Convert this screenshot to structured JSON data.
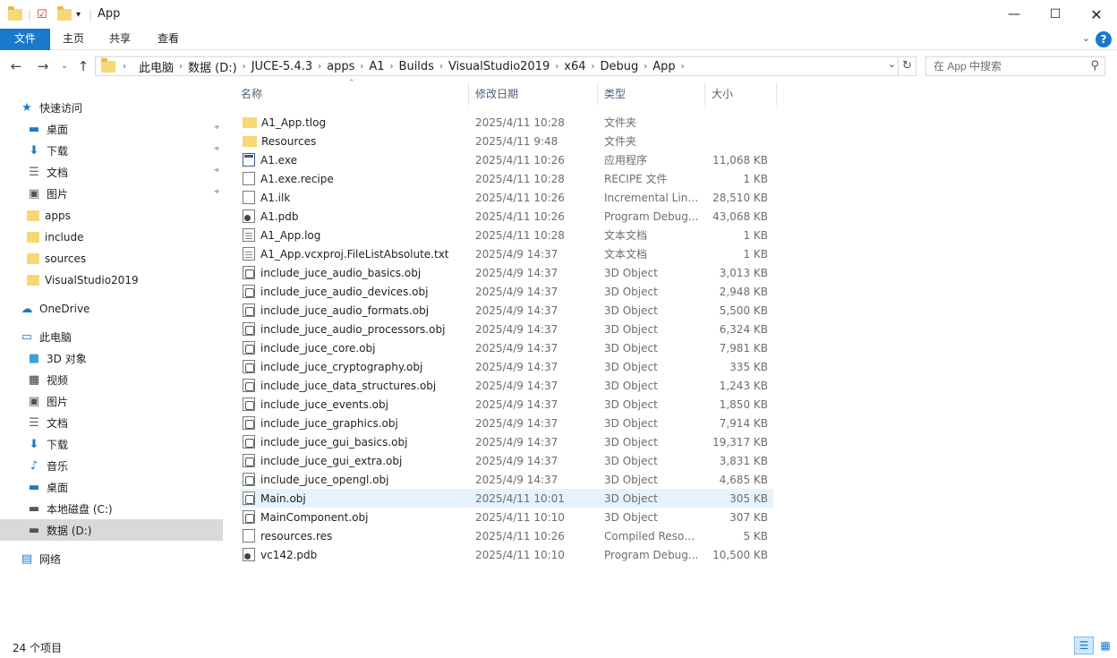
{
  "window": {
    "title": "App"
  },
  "ribbon": {
    "tabs": [
      "文件",
      "主页",
      "共享",
      "查看"
    ],
    "help": "?"
  },
  "address": {
    "crumbs": [
      "此电脑",
      "数据 (D:)",
      "JUCE-5.4.3",
      "apps",
      "A1",
      "Builds",
      "VisualStudio2019",
      "x64",
      "Debug",
      "App"
    ]
  },
  "search": {
    "placeholder": "在 App 中搜索"
  },
  "sidebar": {
    "items": [
      {
        "label": "快速访问",
        "icon": "star-icon"
      },
      {
        "label": "桌面",
        "icon": "desktop-icon",
        "pinned": true
      },
      {
        "label": "下载",
        "icon": "download-icon",
        "pinned": true
      },
      {
        "label": "文档",
        "icon": "document-icon",
        "pinned": true
      },
      {
        "label": "图片",
        "icon": "picture-icon",
        "pinned": true
      },
      {
        "label": "apps",
        "icon": "folder-icon"
      },
      {
        "label": "include",
        "icon": "folder-icon"
      },
      {
        "label": "sources",
        "icon": "folder-icon"
      },
      {
        "label": "VisualStudio2019",
        "icon": "folder-icon"
      },
      {
        "label": "OneDrive",
        "icon": "cloud-icon"
      },
      {
        "label": "此电脑",
        "icon": "computer-icon"
      },
      {
        "label": "3D 对象",
        "icon": "cube-icon"
      },
      {
        "label": "视频",
        "icon": "video-icon"
      },
      {
        "label": "图片",
        "icon": "picture-icon"
      },
      {
        "label": "文档",
        "icon": "document-icon"
      },
      {
        "label": "下载",
        "icon": "download-icon"
      },
      {
        "label": "音乐",
        "icon": "music-icon"
      },
      {
        "label": "桌面",
        "icon": "desktop-icon"
      },
      {
        "label": "本地磁盘 (C:)",
        "icon": "drive-icon"
      },
      {
        "label": "数据 (D:)",
        "icon": "drive-icon",
        "selected": true
      },
      {
        "label": "网络",
        "icon": "network-icon"
      }
    ]
  },
  "columns": {
    "name": "名称",
    "date": "修改日期",
    "type": "类型",
    "size": "大小"
  },
  "files": [
    {
      "name": "A1_App.tlog",
      "date": "2025/4/11 10:28",
      "type": "文件夹",
      "size": "",
      "icon": "folder"
    },
    {
      "name": "Resources",
      "date": "2025/4/11 9:48",
      "type": "文件夹",
      "size": "",
      "icon": "folder"
    },
    {
      "name": "A1.exe",
      "date": "2025/4/11 10:26",
      "type": "应用程序",
      "size": "11,068 KB",
      "icon": "exe"
    },
    {
      "name": "A1.exe.recipe",
      "date": "2025/4/11 10:28",
      "type": "RECIPE 文件",
      "size": "1 KB",
      "icon": "file"
    },
    {
      "name": "A1.ilk",
      "date": "2025/4/11 10:26",
      "type": "Incremental Link...",
      "size": "28,510 KB",
      "icon": "file"
    },
    {
      "name": "A1.pdb",
      "date": "2025/4/11 10:26",
      "type": "Program Debug...",
      "size": "43,068 KB",
      "icon": "pdb"
    },
    {
      "name": "A1_App.log",
      "date": "2025/4/11 10:28",
      "type": "文本文档",
      "size": "1 KB",
      "icon": "txt"
    },
    {
      "name": "A1_App.vcxproj.FileListAbsolute.txt",
      "date": "2025/4/9 14:37",
      "type": "文本文档",
      "size": "1 KB",
      "icon": "txt"
    },
    {
      "name": "include_juce_audio_basics.obj",
      "date": "2025/4/9 14:37",
      "type": "3D Object",
      "size": "3,013 KB",
      "icon": "obj"
    },
    {
      "name": "include_juce_audio_devices.obj",
      "date": "2025/4/9 14:37",
      "type": "3D Object",
      "size": "2,948 KB",
      "icon": "obj"
    },
    {
      "name": "include_juce_audio_formats.obj",
      "date": "2025/4/9 14:37",
      "type": "3D Object",
      "size": "5,500 KB",
      "icon": "obj"
    },
    {
      "name": "include_juce_audio_processors.obj",
      "date": "2025/4/9 14:37",
      "type": "3D Object",
      "size": "6,324 KB",
      "icon": "obj"
    },
    {
      "name": "include_juce_core.obj",
      "date": "2025/4/9 14:37",
      "type": "3D Object",
      "size": "7,981 KB",
      "icon": "obj"
    },
    {
      "name": "include_juce_cryptography.obj",
      "date": "2025/4/9 14:37",
      "type": "3D Object",
      "size": "335 KB",
      "icon": "obj"
    },
    {
      "name": "include_juce_data_structures.obj",
      "date": "2025/4/9 14:37",
      "type": "3D Object",
      "size": "1,243 KB",
      "icon": "obj"
    },
    {
      "name": "include_juce_events.obj",
      "date": "2025/4/9 14:37",
      "type": "3D Object",
      "size": "1,850 KB",
      "icon": "obj"
    },
    {
      "name": "include_juce_graphics.obj",
      "date": "2025/4/9 14:37",
      "type": "3D Object",
      "size": "7,914 KB",
      "icon": "obj"
    },
    {
      "name": "include_juce_gui_basics.obj",
      "date": "2025/4/9 14:37",
      "type": "3D Object",
      "size": "19,317 KB",
      "icon": "obj"
    },
    {
      "name": "include_juce_gui_extra.obj",
      "date": "2025/4/9 14:37",
      "type": "3D Object",
      "size": "3,831 KB",
      "icon": "obj"
    },
    {
      "name": "include_juce_opengl.obj",
      "date": "2025/4/9 14:37",
      "type": "3D Object",
      "size": "4,685 KB",
      "icon": "obj"
    },
    {
      "name": "Main.obj",
      "date": "2025/4/11 10:01",
      "type": "3D Object",
      "size": "305 KB",
      "icon": "obj",
      "hover": true
    },
    {
      "name": "MainComponent.obj",
      "date": "2025/4/11 10:10",
      "type": "3D Object",
      "size": "307 KB",
      "icon": "obj"
    },
    {
      "name": "resources.res",
      "date": "2025/4/11 10:26",
      "type": "Compiled Resou...",
      "size": "5 KB",
      "icon": "file"
    },
    {
      "name": "vc142.pdb",
      "date": "2025/4/11 10:10",
      "type": "Program Debug...",
      "size": "10,500 KB",
      "icon": "pdb"
    }
  ],
  "status": {
    "count": "24 个项目"
  }
}
